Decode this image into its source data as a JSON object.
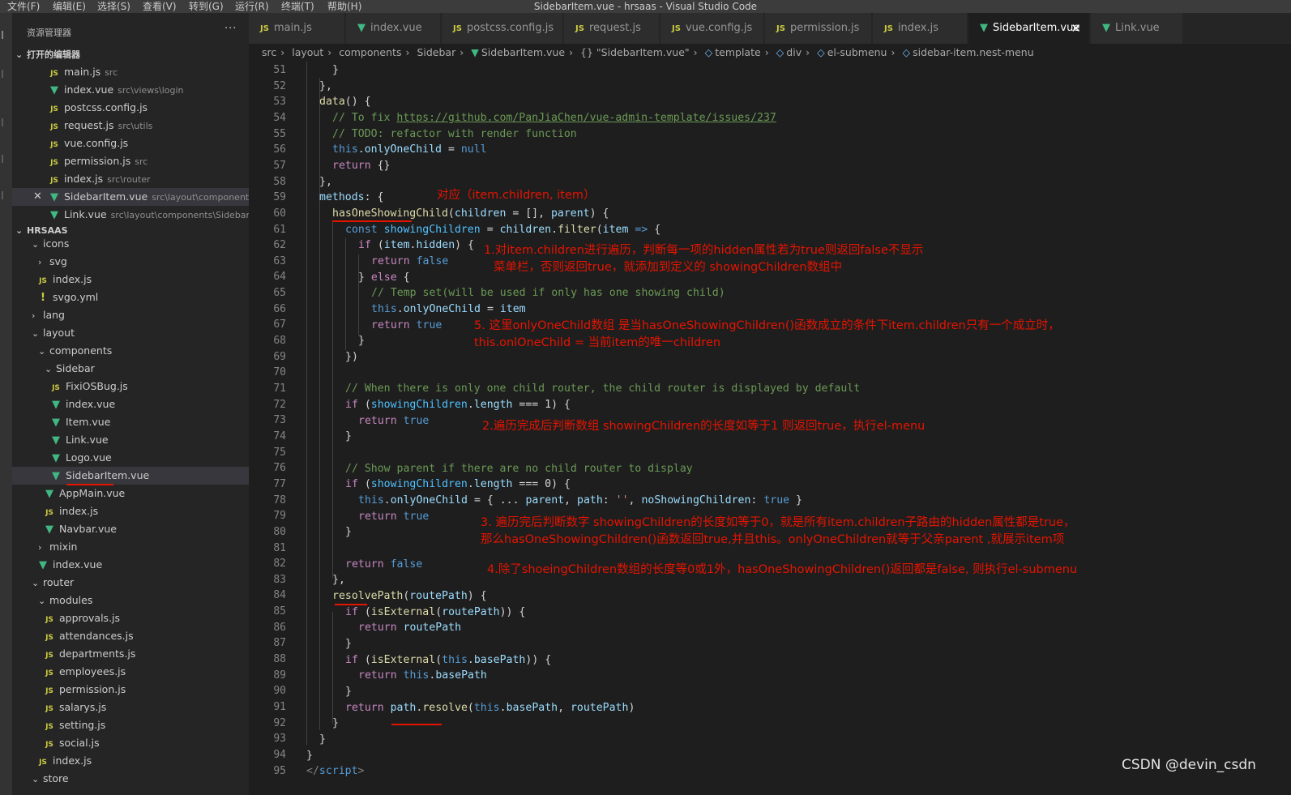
{
  "window": {
    "title": "SidebarItem.vue - hrsaas - Visual Studio Code"
  },
  "menu": [
    "文件(F)",
    "编辑(E)",
    "选择(S)",
    "查看(V)",
    "转到(G)",
    "运行(R)",
    "终端(T)",
    "帮助(H)"
  ],
  "sidebar": {
    "title": "资源管理器",
    "more": "···",
    "open_editors_title": "打开的编辑器",
    "open_editors": [
      {
        "name": "main.js",
        "dir": "src",
        "icon": "js-icon"
      },
      {
        "name": "index.vue",
        "dir": "src\\views\\login",
        "icon": "vue-icon"
      },
      {
        "name": "postcss.config.js",
        "dir": "",
        "icon": "js-icon"
      },
      {
        "name": "request.js",
        "dir": "src\\utils",
        "icon": "js-icon"
      },
      {
        "name": "vue.config.js",
        "dir": "",
        "icon": "js-icon"
      },
      {
        "name": "permission.js",
        "dir": "src",
        "icon": "js-icon"
      },
      {
        "name": "index.js",
        "dir": "src\\router",
        "icon": "js-icon"
      },
      {
        "name": "SidebarItem.vue",
        "dir": "src\\layout\\components\\...",
        "icon": "vue-icon"
      },
      {
        "name": "Link.vue",
        "dir": "src\\layout\\components\\Sidebar",
        "icon": "vue-icon"
      }
    ],
    "project_title": "HRSAAS",
    "tree": [
      {
        "name": "icons",
        "type": "folder-open"
      },
      {
        "name": "svg",
        "type": "folder-closed"
      },
      {
        "name": "index.js",
        "type": "js"
      },
      {
        "name": "svgo.yml",
        "type": "yml"
      },
      {
        "name": "lang",
        "type": "folder-closed"
      },
      {
        "name": "layout",
        "type": "folder-open"
      },
      {
        "name": "components",
        "type": "folder-open"
      },
      {
        "name": "Sidebar",
        "type": "folder-open"
      },
      {
        "name": "FixiOSBug.js",
        "type": "js"
      },
      {
        "name": "index.vue",
        "type": "vue"
      },
      {
        "name": "Item.vue",
        "type": "vue"
      },
      {
        "name": "Link.vue",
        "type": "vue"
      },
      {
        "name": "Logo.vue",
        "type": "vue"
      },
      {
        "name": "SidebarItem.vue",
        "type": "vue"
      },
      {
        "name": "AppMain.vue",
        "type": "vue"
      },
      {
        "name": "index.js",
        "type": "js"
      },
      {
        "name": "Navbar.vue",
        "type": "vue"
      },
      {
        "name": "mixin",
        "type": "folder-closed"
      },
      {
        "name": "index.vue",
        "type": "vue"
      },
      {
        "name": "router",
        "type": "folder-open"
      },
      {
        "name": "modules",
        "type": "folder-open"
      },
      {
        "name": "approvals.js",
        "type": "js"
      },
      {
        "name": "attendances.js",
        "type": "js"
      },
      {
        "name": "departments.js",
        "type": "js"
      },
      {
        "name": "employees.js",
        "type": "js"
      },
      {
        "name": "permission.js",
        "type": "js"
      },
      {
        "name": "salarys.js",
        "type": "js"
      },
      {
        "name": "setting.js",
        "type": "js"
      },
      {
        "name": "social.js",
        "type": "js"
      },
      {
        "name": "index.js",
        "type": "js"
      },
      {
        "name": "store",
        "type": "folder-open"
      }
    ]
  },
  "tabs": [
    {
      "label": "main.js",
      "icon": "js-icon"
    },
    {
      "label": "index.vue",
      "icon": "vue-icon"
    },
    {
      "label": "postcss.config.js",
      "icon": "js-icon"
    },
    {
      "label": "request.js",
      "icon": "js-icon"
    },
    {
      "label": "vue.config.js",
      "icon": "js-icon"
    },
    {
      "label": "permission.js",
      "icon": "js-icon"
    },
    {
      "label": "index.js",
      "icon": "js-icon"
    },
    {
      "label": "SidebarItem.vue",
      "icon": "vue-icon",
      "active": true
    },
    {
      "label": "Link.vue",
      "icon": "vue-icon"
    }
  ],
  "tab_close": "✕",
  "breadcrumb": [
    "src",
    "layout",
    "components",
    "Sidebar",
    "SidebarItem.vue",
    "{} \"SidebarItem.vue\"",
    "template",
    "div",
    "el-submenu",
    "sidebar-item.nest-menu"
  ],
  "editor": {
    "line_numbers": [
      "51",
      "52",
      "53",
      "54",
      "55",
      "56",
      "57",
      "58",
      "59",
      "60",
      "61",
      "62",
      "63",
      "64",
      "65",
      "66",
      "67",
      "68",
      "69",
      "70",
      "71",
      "72",
      "73",
      "74",
      "75",
      "76",
      "77",
      "78",
      "79",
      "80",
      "81",
      "82",
      "83",
      "84",
      "85",
      "86",
      "87",
      "88",
      "89",
      "90",
      "91",
      "92",
      "93",
      "94",
      "95"
    ],
    "lines": {
      "l51": "}",
      "l52": "},",
      "l53a": "data",
      "l53b": "() {",
      "l54a": "// To fix ",
      "l54b": "https://github.com/PanJiaChen/vue-admin-template/issues/237",
      "l55": "// TODO: refactor with render function",
      "l56a": "this",
      "l56b": ".",
      "l56c": "onlyOneChild",
      "l56d": " = ",
      "l56e": "null",
      "l57a": "return",
      "l57b": " {}",
      "l58": "},",
      "l59a": "methods",
      "l59b": ": {",
      "l60a": "hasOneShowingChild",
      "l60b": "(",
      "l60c": "children",
      "l60d": " = [], ",
      "l60e": "parent",
      "l60f": ") {",
      "l61a": "const",
      "l61b": "showingChildren",
      "l61c": " = ",
      "l61d": "children",
      "l61e": ".",
      "l61f": "filter",
      "l61g": "(",
      "l61h": "item",
      "l61i": " => ",
      "l61j": "{",
      "l62a": "if",
      "l62b": " (",
      "l62c": "item",
      "l62d": ".",
      "l62e": "hidden",
      "l62f": ") {",
      "l63a": "return",
      "l63b": "false",
      "l64a": "} ",
      "l64b": "else",
      "l64c": " {",
      "l65": "// Temp set(will be used if only has one showing child)",
      "l66a": "this",
      "l66b": ".",
      "l66c": "onlyOneChild",
      "l66d": " = ",
      "l66e": "item",
      "l67a": "return",
      "l67b": "true",
      "l68": "}",
      "l69": "})",
      "l71": "// When there is only one child router, the child router is displayed by default",
      "l72a": "if",
      "l72b": " (",
      "l72c": "showingChildren",
      "l72d": ".",
      "l72e": "length",
      "l72f": " === ",
      "l72g": "1",
      "l72h": ") {",
      "l73a": "return",
      "l73b": "true",
      "l74": "}",
      "l76": "// Show parent if there are no child router to display",
      "l77a": "if",
      "l77b": " (",
      "l77c": "showingChildren",
      "l77d": ".",
      "l77e": "length",
      "l77f": " === ",
      "l77g": "0",
      "l77h": ") {",
      "l78a": "this",
      "l78b": ".",
      "l78c": "onlyOneChild",
      "l78d": " = { ... ",
      "l78e": "parent",
      "l78f": ", ",
      "l78g": "path",
      "l78h": ": ",
      "l78i": "''",
      "l78j": ", ",
      "l78k": "noShowingChildren",
      "l78l": ": ",
      "l78m": "true",
      "l78n": " }",
      "l79a": "return",
      "l79b": "true",
      "l80": "}",
      "l82a": "return",
      "l82b": "false",
      "l83": "},",
      "l84a": "resolvePath",
      "l84b": "(",
      "l84c": "routePath",
      "l84d": ") {",
      "l85a": "if",
      "l85b": " (",
      "l85c": "isExternal",
      "l85d": "(",
      "l85e": "routePath",
      "l85f": ")) {",
      "l86a": "return",
      "l86b": "routePath",
      "l87": "}",
      "l88a": "if",
      "l88b": " (",
      "l88c": "isExternal",
      "l88d": "(",
      "l88e": "this",
      "l88f": ".",
      "l88g": "basePath",
      "l88h": ")) {",
      "l89a": "return",
      "l89b": "this",
      "l89c": ".",
      "l89d": "basePath",
      "l90": "}",
      "l91a": "return",
      "l91b": "path",
      "l91c": ".",
      "l91d": "resolve",
      "l91e": "(",
      "l91f": "this",
      "l91g": ".",
      "l91h": "basePath",
      "l91i": ", ",
      "l91j": "routePath",
      "l91k": ")",
      "l92": "}",
      "l93": "}",
      "l94": "}",
      "l95a": "</",
      "l95b": "script",
      "l95c": ">"
    }
  },
  "annotations": {
    "n0": "对应（item.children, item）",
    "n1a": "1.对item.children进行遍历，判断每一项的hidden属性若为true则返回false不显示",
    "n1b": "菜单栏，否则返回true，就添加到定义的 showingChildren数组中",
    "n5a": "5. 这里onlyOneChild数组 是当hasOneShowingChildren()函数成立的条件下item.children只有一个成立时，",
    "n5b": "this.onlOneChild = 当前item的唯一children",
    "n2": "2.遍历完成后判断数组 showingChildren的长度如等于1 则返回true，执行el-menu",
    "n3a": "3. 遍历完后判断数字 showingChildren的长度如等于0，就是所有item.children子路由的hidden属性都是true，",
    "n3b": "那么hasOneShowingChildren()函数返回true,并且this。onlyOneChildren就等于父亲parent ,就展示item项",
    "n4": "4.除了shoeingChildren数组的长度等0或1外，hasOneShowingChildren()返回都是false, 则执行el-submenu"
  },
  "watermark": "CSDN @devin_csdn"
}
